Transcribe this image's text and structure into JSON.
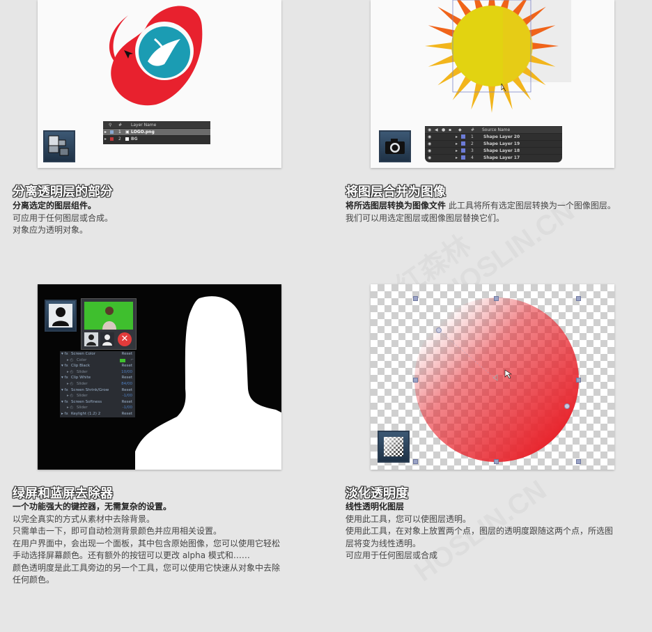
{
  "watermark": {
    "cn": "红森林",
    "en": "HOSLIN.CN"
  },
  "cards": [
    {
      "title": "分离透明层的部分",
      "lines": [
        {
          "bold": "分离选定的图层组件。",
          "text": ""
        },
        {
          "bold": "",
          "text": "可应用于任何图层或合成。"
        },
        {
          "bold": "",
          "text": "对象应为透明对象。"
        }
      ],
      "layers": {
        "header": {
          "num": "#",
          "name": "Layer Name"
        },
        "rows": [
          {
            "num": "1",
            "name": "LOGO.png"
          },
          {
            "num": "2",
            "name": "BG"
          }
        ]
      },
      "colors": {
        "logo_red": "#e8212e",
        "logo_teal": "#1b9cb3"
      }
    },
    {
      "title": "将图层合并为图像",
      "lines": [
        {
          "bold": "将所选图层转换为图像文件",
          "text": " 此工具将所有选定图层转换为一个图像图层。"
        },
        {
          "bold": "",
          "text": "我们可以用选定图层或图像图层替换它们。"
        }
      ],
      "layers": {
        "header": {
          "num": "#",
          "name": "Source Name"
        },
        "rows": [
          {
            "num": "1",
            "name": "Shape Layer 20"
          },
          {
            "num": "2",
            "name": "Shape Layer 19"
          },
          {
            "num": "3",
            "name": "Shape Layer 18"
          },
          {
            "num": "4",
            "name": "Shape Layer 17"
          }
        ]
      },
      "colors": {
        "sun_core": "#e2d311",
        "ray_orange": "#f0641a",
        "ray_yellow": "#f2b51c"
      }
    },
    {
      "title": "绿屏和蓝屏去除器",
      "lines": [
        {
          "bold": "一个功能强大的键控器，无需复杂的设置。",
          "text": ""
        },
        {
          "bold": "",
          "text": "以完全真实的方式从素材中去除背景。"
        },
        {
          "bold": "",
          "text": "只需单击一下，即可自动检测背景颜色并应用相关设置。"
        },
        {
          "bold": "",
          "text": "在用户界面中，会出现一个面板，其中包含原始图像，您可以使用它轻松"
        },
        {
          "bold": "",
          "text": "手动选择屏幕颜色。还有额外的按钮可以更改 alpha 模式和……"
        },
        {
          "bold": "",
          "text": "颜色透明度是此工具旁边的另一个工具，您可以使用它快速从对象中去除"
        },
        {
          "bold": "",
          "text": "任何颜色。"
        }
      ],
      "controls": [
        {
          "label": "Screen Color",
          "value": "Reset",
          "type": "group"
        },
        {
          "label": "Color",
          "value": "",
          "type": "sub"
        },
        {
          "label": "Clip Black",
          "value": "Reset",
          "type": "group"
        },
        {
          "label": "Slider",
          "value": "10/00",
          "type": "sub"
        },
        {
          "label": "Clip White",
          "value": "Reset",
          "type": "group"
        },
        {
          "label": "Slider",
          "value": "84/00",
          "type": "sub"
        },
        {
          "label": "Screen Shrink/Grow",
          "value": "Reset",
          "type": "group"
        },
        {
          "label": "Slider",
          "value": "-1/00",
          "type": "sub"
        },
        {
          "label": "Screen Softness",
          "value": "Reset",
          "type": "group"
        },
        {
          "label": "Slider",
          "value": "-1/00",
          "type": "sub"
        },
        {
          "label": "Keylight (1.2) 2",
          "value": "Reset",
          "type": "group"
        }
      ],
      "colors": {
        "green_screen": "#3fbf2e",
        "remove_red": "#e23b3b"
      }
    },
    {
      "title": "淡化透明度",
      "lines": [
        {
          "bold": "线性透明化图层",
          "text": ""
        },
        {
          "bold": "",
          "text": "使用此工具，您可以使图层透明。"
        },
        {
          "bold": "",
          "text": "使用此工具，在对象上放置两个点，图层的透明度跟随这两个点，所选图"
        },
        {
          "bold": "",
          "text": "层将变为线性透明。"
        },
        {
          "bold": "",
          "text": "可应用于任何图层或合成"
        }
      ],
      "colors": {
        "circle_red": "#e8262e"
      }
    }
  ]
}
